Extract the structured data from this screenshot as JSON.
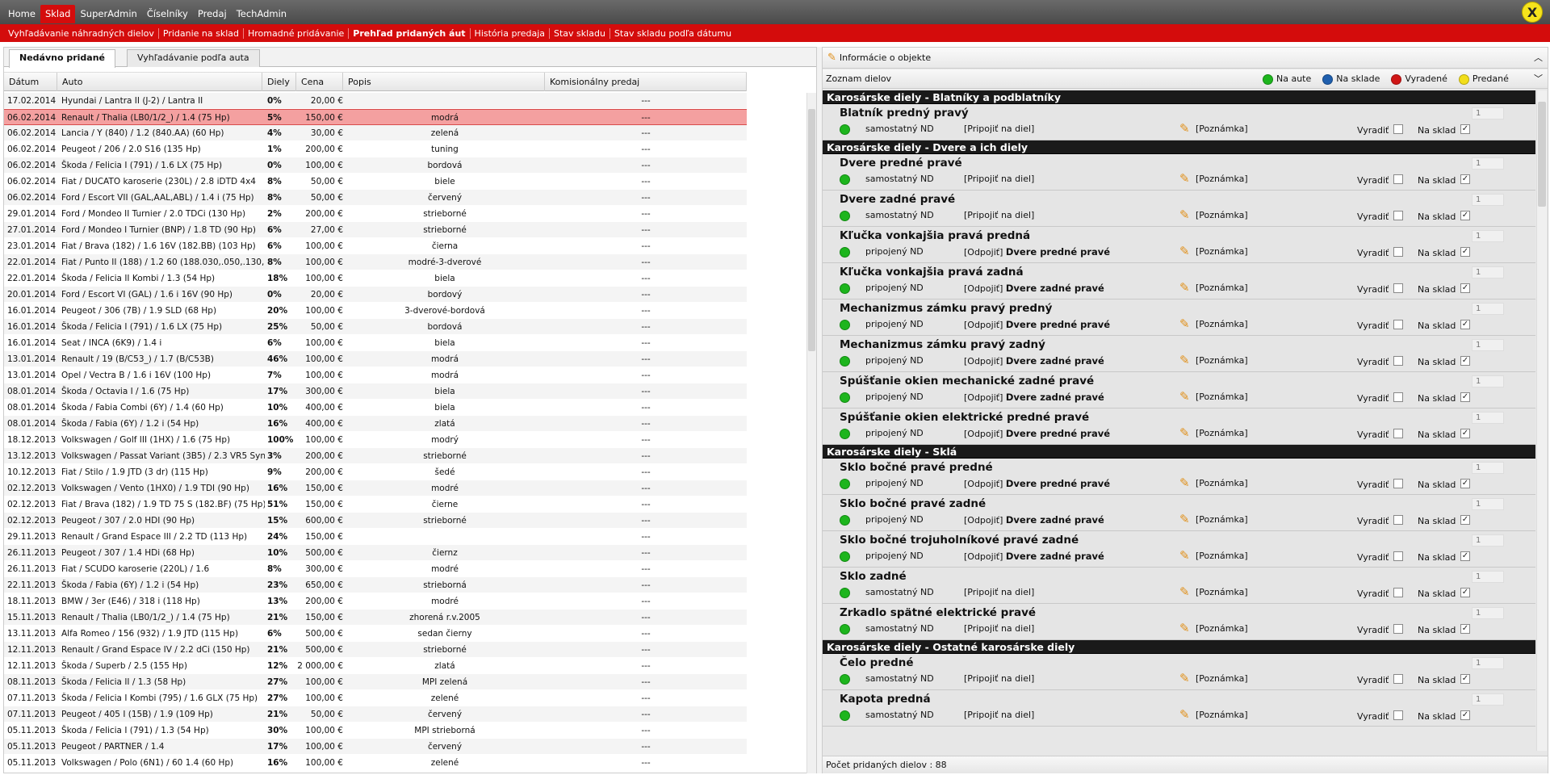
{
  "topmenu": {
    "items": [
      "Home",
      "Sklad",
      "SuperAdmin",
      "Číselníky",
      "Predaj",
      "TechAdmin"
    ],
    "active_index": 1,
    "close_label": "X"
  },
  "submenu": {
    "items": [
      "Vyhľadávanie náhradných dielov",
      "Pridanie na sklad",
      "Hromadné pridávanie",
      "Prehľad pridaných áut",
      "História predaja",
      "Stav skladu",
      "Stav skladu podľa dátumu"
    ],
    "active_index": 3
  },
  "left": {
    "tabs": [
      "Nedávno pridané",
      "Vyhľadávanie podľa auta"
    ],
    "columns": [
      "Dátum",
      "Auto",
      "Diely",
      "Cena",
      "Popis",
      "Komisionálny predaj"
    ],
    "rows": [
      [
        "17.02.2014",
        "Hyundai / Lantra II (J-2) / Lantra II",
        "0%",
        "20,00 €",
        "",
        "---"
      ],
      [
        "06.02.2014",
        "Renault / Thalia (LB0/1/2_) / 1.4 (75 Hp)",
        "5%",
        "150,00 €",
        "modrá",
        "---"
      ],
      [
        "06.02.2014",
        "Lancia / Y (840) / 1.2 (840.AA) (60 Hp)",
        "4%",
        "30,00 €",
        "zelená",
        "---"
      ],
      [
        "06.02.2014",
        "Peugeot / 206 / 2.0 S16 (135 Hp)",
        "1%",
        "200,00 €",
        "tuning",
        "---"
      ],
      [
        "06.02.2014",
        "Škoda / Felicia I (791) / 1.6 LX (75 Hp)",
        "0%",
        "100,00 €",
        "bordová",
        "---"
      ],
      [
        "06.02.2014",
        "Fiat / DUCATO karoserie (230L) / 2.8 iDTD 4x4",
        "8%",
        "50,00 €",
        "biele",
        "---"
      ],
      [
        "06.02.2014",
        "Ford / Escort VII (GAL,AAL,ABL) / 1.4 i (75 Hp)",
        "8%",
        "50,00 €",
        "červený",
        "---"
      ],
      [
        "29.01.2014",
        "Ford / Mondeo II Turnier / 2.0 TDCi (130 Hp)",
        "2%",
        "200,00 €",
        "strieborné",
        "---"
      ],
      [
        "27.01.2014",
        "Ford / Mondeo I Turnier (BNP) / 1.8 TD (90 Hp)",
        "6%",
        "27,00 €",
        "strieborné",
        "---"
      ],
      [
        "23.01.2014",
        "Fiat / Brava (182) / 1.6 16V (182.BB) (103 Hp)",
        "6%",
        "100,00 €",
        "čierna",
        "---"
      ],
      [
        "22.01.2014",
        "Fiat / Punto II (188) / 1.2 60 (188.030,.050,.130,.",
        "8%",
        "100,00 €",
        "modré-3-dverové",
        "---"
      ],
      [
        "22.01.2014",
        "Škoda / Felicia II Kombi / 1.3 (54 Hp)",
        "18%",
        "100,00 €",
        "biela",
        "---"
      ],
      [
        "20.01.2014",
        "Ford / Escort VI (GAL) / 1.6 i 16V (90 Hp)",
        "0%",
        "20,00 €",
        "bordový",
        "---"
      ],
      [
        "16.01.2014",
        "Peugeot / 306 (7B) / 1.9 SLD (68 Hp)",
        "20%",
        "100,00 €",
        "3-dverové-bordová",
        "---"
      ],
      [
        "16.01.2014",
        "Škoda / Felicia I (791) / 1.6 LX (75 Hp)",
        "25%",
        "50,00 €",
        "bordová",
        "---"
      ],
      [
        "16.01.2014",
        "Seat / INCA (6K9) / 1.4 i",
        "6%",
        "100,00 €",
        "biela",
        "---"
      ],
      [
        "13.01.2014",
        "Renault / 19 (B/C53_) / 1.7 (B/C53B)",
        "46%",
        "100,00 €",
        "modrá",
        "---"
      ],
      [
        "13.01.2014",
        "Opel / Vectra B / 1.6 i 16V (100 Hp)",
        "7%",
        "100,00 €",
        "modrá",
        "---"
      ],
      [
        "08.01.2014",
        "Škoda / Octavia I / 1.6 (75 Hp)",
        "17%",
        "300,00 €",
        "biela",
        "---"
      ],
      [
        "08.01.2014",
        "Škoda / Fabia Combi (6Y) / 1.4 (60 Hp)",
        "10%",
        "400,00 €",
        "biela",
        "---"
      ],
      [
        "08.01.2014",
        "Škoda / Fabia (6Y) / 1.2 i (54 Hp)",
        "16%",
        "400,00 €",
        "zlatá",
        "---"
      ],
      [
        "18.12.2013",
        "Volkswagen / Golf III (1HX) / 1.6 (75 Hp)",
        "100%",
        "100,00 €",
        "modrý",
        "---"
      ],
      [
        "13.12.2013",
        "Volkswagen / Passat Variant (3B5) / 2.3 VR5 Syncro",
        "3%",
        "200,00 €",
        "strieborné",
        "---"
      ],
      [
        "10.12.2013",
        "Fiat / Stilo / 1.9 JTD (3 dr) (115 Hp)",
        "9%",
        "200,00 €",
        "šedé",
        "---"
      ],
      [
        "02.12.2013",
        "Volkswagen / Vento (1HX0) / 1.9 TDI (90 Hp)",
        "16%",
        "150,00 €",
        "modré",
        "---"
      ],
      [
        "02.12.2013",
        "Fiat / Brava (182) / 1.9 TD 75 S (182.BF) (75 Hp)",
        "51%",
        "150,00 €",
        "čierne",
        "---"
      ],
      [
        "02.12.2013",
        "Peugeot / 307 / 2.0 HDI (90 Hp)",
        "15%",
        "600,00 €",
        "strieborné",
        "---"
      ],
      [
        "29.11.2013",
        "Renault / Grand Espace III / 2.2 TD (113 Hp)",
        "24%",
        "150,00 €",
        "",
        "---"
      ],
      [
        "26.11.2013",
        "Peugeot / 307 / 1.4 HDi (68 Hp)",
        "10%",
        "500,00 €",
        "čiernz",
        "---"
      ],
      [
        "26.11.2013",
        "Fiat / SCUDO karoserie (220L) / 1.6",
        "8%",
        "300,00 €",
        "modré",
        "---"
      ],
      [
        "22.11.2013",
        "Škoda / Fabia (6Y) / 1.2 i (54 Hp)",
        "23%",
        "650,00 €",
        "strieborná",
        "---"
      ],
      [
        "18.11.2013",
        "BMW / 3er (E46) / 318 i (118 Hp)",
        "13%",
        "200,00 €",
        "modré",
        "---"
      ],
      [
        "15.11.2013",
        "Renault / Thalia (LB0/1/2_) / 1.4 (75 Hp)",
        "21%",
        "150,00 €",
        "zhorená r.v.2005",
        "---"
      ],
      [
        "13.11.2013",
        "Alfa Romeo / 156 (932) / 1.9 JTD (115 Hp)",
        "6%",
        "500,00 €",
        "sedan čierny",
        "---"
      ],
      [
        "12.11.2013",
        "Renault / Grand Espace IV / 2.2 dCi (150 Hp)",
        "21%",
        "500,00 €",
        "strieborné",
        "---"
      ],
      [
        "12.11.2013",
        "Škoda / Superb / 2.5 (155 Hp)",
        "12%",
        "2 000,00 €",
        "zlatá",
        "---"
      ],
      [
        "08.11.2013",
        "Škoda / Felicia II / 1.3 (58 Hp)",
        "27%",
        "100,00 €",
        "MPI zelená",
        "---"
      ],
      [
        "07.11.2013",
        "Škoda / Felicia I Kombi (795) / 1.6 GLX (75 Hp)",
        "27%",
        "100,00 €",
        "zelené",
        "---"
      ],
      [
        "07.11.2013",
        "Peugeot / 405 I (15B) / 1.9 (109 Hp)",
        "21%",
        "50,00 €",
        "červený",
        "---"
      ],
      [
        "05.11.2013",
        "Škoda / Felicia I (791) / 1.3 (54 Hp)",
        "30%",
        "100,00 €",
        "MPI strieborná",
        "---"
      ],
      [
        "05.11.2013",
        "Peugeot / PARTNER / 1.4",
        "17%",
        "100,00 €",
        "červený",
        "---"
      ],
      [
        "05.11.2013",
        "Volkswagen / Polo (6N1) / 60 1.4 (60 Hp)",
        "16%",
        "100,00 €",
        "zelené",
        "---"
      ]
    ],
    "highlighted_row": 1
  },
  "right": {
    "header_title": "Informácie o objekte",
    "list_title": "Zoznam dielov",
    "legend": [
      {
        "label": "Na aute",
        "color": "#1db51d"
      },
      {
        "label": "Na sklade",
        "color": "#1f5fae"
      },
      {
        "label": "Vyradené",
        "color": "#d01616"
      },
      {
        "label": "Predané",
        "color": "#f2de1a"
      }
    ],
    "labels": {
      "vyradit": "Vyradiť",
      "na_sklad": "Na sklad",
      "note": "[Poznámka]"
    },
    "categories": [
      {
        "title": "Karosárske diely - Blatníky a podblatníky",
        "parts": [
          {
            "name": "Blatník predný pravý",
            "type": "samostatný ND",
            "action": "[Pripojiť na diel]",
            "target": "",
            "qty": "1"
          }
        ]
      },
      {
        "title": "Karosárske diely - Dvere a ich diely",
        "parts": [
          {
            "name": "Dvere predné pravé",
            "type": "samostatný ND",
            "action": "[Pripojiť na diel]",
            "target": "",
            "qty": "1"
          },
          {
            "name": "Dvere zadné pravé",
            "type": "samostatný ND",
            "action": "[Pripojiť na diel]",
            "target": "",
            "qty": "1"
          },
          {
            "name": "Kľučka vonkajšia pravá predná",
            "type": "pripojený ND",
            "action": "[Odpojiť]",
            "target": "Dvere predné pravé",
            "qty": "1"
          },
          {
            "name": "Kľučka vonkajšia pravá zadná",
            "type": "pripojený ND",
            "action": "[Odpojiť]",
            "target": "Dvere zadné pravé",
            "qty": "1"
          },
          {
            "name": "Mechanizmus zámku pravý predný",
            "type": "pripojený ND",
            "action": "[Odpojiť]",
            "target": "Dvere predné pravé",
            "qty": "1"
          },
          {
            "name": "Mechanizmus zámku pravý zadný",
            "type": "pripojený ND",
            "action": "[Odpojiť]",
            "target": "Dvere zadné pravé",
            "qty": "1"
          },
          {
            "name": "Spúšťanie okien mechanické zadné pravé",
            "type": "pripojený ND",
            "action": "[Odpojiť]",
            "target": "Dvere zadné pravé",
            "qty": "1"
          },
          {
            "name": "Spúšťanie okien elektrické predné pravé",
            "type": "pripojený ND",
            "action": "[Odpojiť]",
            "target": "Dvere predné pravé",
            "qty": "1"
          }
        ]
      },
      {
        "title": "Karosárske diely - Sklá",
        "parts": [
          {
            "name": "Sklo bočné pravé predné",
            "type": "pripojený ND",
            "action": "[Odpojiť]",
            "target": "Dvere predné pravé",
            "qty": "1"
          },
          {
            "name": "Sklo bočné pravé zadné",
            "type": "pripojený ND",
            "action": "[Odpojiť]",
            "target": "Dvere zadné pravé",
            "qty": "1"
          },
          {
            "name": "Sklo bočné trojuholníkové pravé zadné",
            "type": "pripojený ND",
            "action": "[Odpojiť]",
            "target": "Dvere zadné pravé",
            "qty": "1"
          },
          {
            "name": "Sklo zadné",
            "type": "samostatný ND",
            "action": "[Pripojiť na diel]",
            "target": "",
            "qty": "1"
          },
          {
            "name": "Zrkadlo spätné elektrické pravé",
            "type": "samostatný ND",
            "action": "[Pripojiť na diel]",
            "target": "",
            "qty": "1"
          }
        ]
      },
      {
        "title": "Karosárske diely - Ostatné karosárske diely",
        "parts": [
          {
            "name": "Čelo predné",
            "type": "samostatný ND",
            "action": "[Pripojiť na diel]",
            "target": "",
            "qty": "1"
          },
          {
            "name": "Kapota predná",
            "type": "samostatný ND",
            "action": "[Pripojiť na diel]",
            "target": "",
            "qty": "1"
          }
        ]
      }
    ],
    "footer": "Počet pridaných dielov : 88"
  }
}
